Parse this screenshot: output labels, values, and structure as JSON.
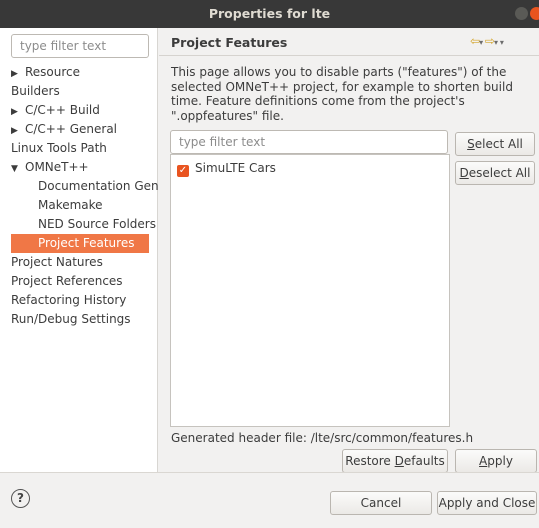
{
  "window": {
    "title": "Properties for lte"
  },
  "left": {
    "filter_placeholder": "type filter text",
    "tree": [
      {
        "label": "Resource",
        "expander": "▶"
      },
      {
        "label": "Builders",
        "expander": ""
      },
      {
        "label": "C/C++ Build",
        "expander": "▶"
      },
      {
        "label": "C/C++ General",
        "expander": "▶"
      },
      {
        "label": "Linux Tools Path",
        "expander": ""
      },
      {
        "label": "OMNeT++",
        "expander": "▼"
      },
      {
        "label": "Documentation Gen"
      },
      {
        "label": "Makemake"
      },
      {
        "label": "NED Source Folders"
      },
      {
        "label": "Project Features",
        "selected": true
      },
      {
        "label": "Project Natures",
        "expander": ""
      },
      {
        "label": "Project References",
        "expander": ""
      },
      {
        "label": "Refactoring History",
        "expander": ""
      },
      {
        "label": "Run/Debug Settings",
        "expander": ""
      }
    ]
  },
  "page": {
    "title": "Project Features",
    "nav_icons": {
      "back": "⇦",
      "forward": "⇨",
      "dropdown": "▾"
    },
    "description": "This page allows you to disable parts (\"features\") of the selected OMNeT++ project, for example to shorten build time. Feature definitions come from the project's \".oppfeatures\" file.",
    "filter_placeholder": "type filter text",
    "features": [
      {
        "label": "SimuLTE Cars",
        "checked": true
      }
    ],
    "select_all": {
      "mnemonic": "S",
      "rest": "elect All"
    },
    "deselect_all": {
      "mnemonic": "D",
      "rest": "eselect All"
    },
    "generated_header": "Generated header file: /lte/src/common/features.h",
    "restore_defaults": {
      "prefix": "Restore ",
      "mnemonic": "D",
      "rest": "efaults"
    },
    "apply": {
      "mnemonic": "A",
      "rest": "pply"
    }
  },
  "footer": {
    "help_glyph": "?",
    "cancel": "Cancel",
    "apply_close": "Apply and Close"
  },
  "colors": {
    "accent": "#f07746",
    "titlebar": "#383838",
    "checkbox": "#e95420",
    "close": "#e9541f"
  }
}
